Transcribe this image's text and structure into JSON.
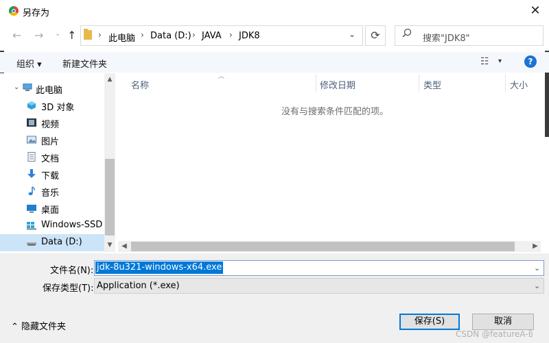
{
  "window": {
    "title": "另存为",
    "close_glyph": "✕"
  },
  "nav": {
    "back_glyph": "←",
    "forward_glyph": "→",
    "up_glyph": "↑",
    "breadcrumbs": [
      "此电脑",
      "Data (D:)",
      "JAVA",
      "JDK8"
    ],
    "separator": "›",
    "refresh_glyph": "⟳",
    "dropdown_glyph": "⌄"
  },
  "search": {
    "placeholder": "搜索\"JDK8\""
  },
  "toolbar": {
    "organize_label": "组织 ▾",
    "new_folder_label": "新建文件夹",
    "view_glyph": "☷",
    "view_dd_glyph": "▾",
    "help_glyph": "?"
  },
  "sidebar": {
    "items": [
      {
        "label": "此电脑",
        "icon": "computer-icon"
      },
      {
        "label": "3D 对象",
        "icon": "3d-objects-icon"
      },
      {
        "label": "视频",
        "icon": "video-icon"
      },
      {
        "label": "图片",
        "icon": "pictures-icon"
      },
      {
        "label": "文档",
        "icon": "documents-icon"
      },
      {
        "label": "下载",
        "icon": "download-icon"
      },
      {
        "label": "音乐",
        "icon": "music-icon"
      },
      {
        "label": "桌面",
        "icon": "desktop-icon"
      },
      {
        "label": "Windows-SSD (",
        "icon": "drive-icon"
      },
      {
        "label": "Data (D:)",
        "icon": "drive-icon"
      }
    ]
  },
  "file_list": {
    "columns": [
      "名称",
      "修改日期",
      "类型",
      "大小"
    ],
    "empty_message": "没有与搜索条件匹配的项。"
  },
  "form": {
    "filename_label": "文件名(N):",
    "filename_value": "jdk-8u321-windows-x64.exe",
    "filetype_label": "保存类型(T):",
    "filetype_value": "Application (*.exe)"
  },
  "footer": {
    "hide_folders_label": "⌃  隐藏文件夹",
    "save_label": "保存(S)",
    "cancel_label": "取消"
  },
  "watermark": "CSDN @featureA-ยิ"
}
